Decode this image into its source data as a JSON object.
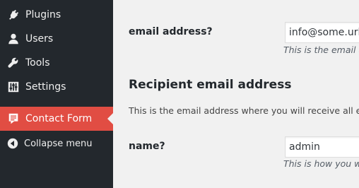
{
  "sidebar": {
    "items": [
      {
        "label": "Plugins",
        "icon": "plug-icon"
      },
      {
        "label": "Users",
        "icon": "user-icon"
      },
      {
        "label": "Tools",
        "icon": "wrench-icon"
      },
      {
        "label": "Settings",
        "icon": "sliders-icon"
      },
      {
        "label": "Contact Form",
        "icon": "form-icon",
        "active": true
      }
    ],
    "collapse_label": "Collapse menu",
    "colors": {
      "background": "#23282d",
      "active": "#e14d43",
      "text": "#eeeeee"
    }
  },
  "main": {
    "email_field": {
      "label": "email address?",
      "value": "info@some.url",
      "description": "This is the email ad"
    },
    "recipient_section": {
      "title": "Recipient email address",
      "description": "This is the email address where you will receive all em"
    },
    "name_field": {
      "label": "name?",
      "value": "admin",
      "description": "This is how you wil"
    }
  }
}
